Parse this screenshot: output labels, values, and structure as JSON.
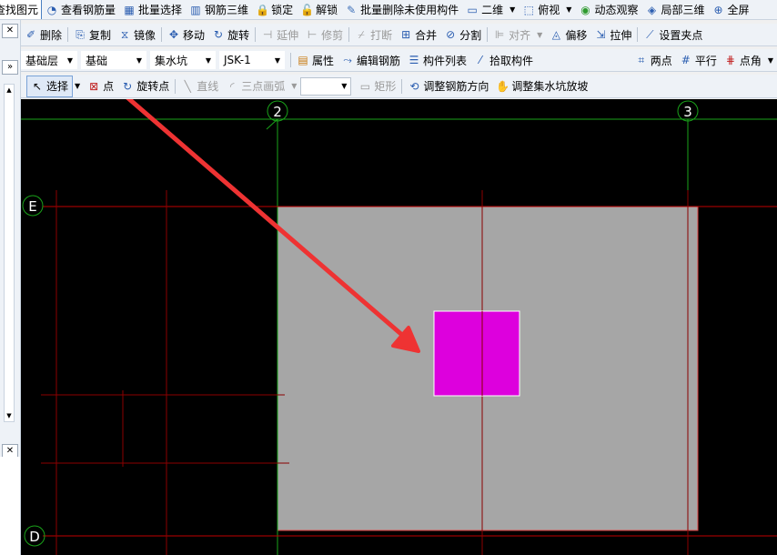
{
  "toolbar1": {
    "find_element": "查找图元",
    "view_rebar_qty": "查看钢筋量",
    "batch_select": "批量选择",
    "rebar_3d": "钢筋三维",
    "lock": "锁定",
    "unlock": "解锁",
    "batch_delete_unused": "批量删除未使用构件",
    "view_2d": "二维",
    "top_view": "俯视",
    "dynamic_observe": "动态观察",
    "local_3d": "局部三维",
    "fullscreen": "全屏"
  },
  "toolbar2": {
    "delete": "删除",
    "copy": "复制",
    "mirror": "镜像",
    "move": "移动",
    "rotate": "旋转",
    "extend": "延伸",
    "trim": "修剪",
    "break": "打断",
    "merge": "合并",
    "split": "分割",
    "align": "对齐",
    "offset": "偏移",
    "stretch": "拉伸",
    "set_grip": "设置夹点"
  },
  "toolbar3": {
    "layer": "基础层",
    "category": "基础",
    "component_type": "集水坑",
    "component_name": "JSK-1",
    "properties": "属性",
    "edit_rebar": "编辑钢筋",
    "component_list": "构件列表",
    "pick_component": "拾取构件",
    "two_point": "两点",
    "parallel": "平行",
    "point_angle": "点角"
  },
  "toolbar4": {
    "select": "选择",
    "point": "点",
    "rotate_point": "旋转点",
    "line": "直线",
    "three_point_arc": "三点画弧",
    "rect": "矩形",
    "adjust_rebar_dir": "调整钢筋方向",
    "adjust_pit_slope": "调整集水坑放坡"
  },
  "canvas": {
    "axis_labels": {
      "col_2": "2",
      "col_3": "3",
      "row_E": "E",
      "row_D": "D"
    },
    "colors": {
      "background": "#000000",
      "slab": "#a6a6a6",
      "pit": "#dd00dd",
      "axis_line": "#c00000",
      "grid_green": "#1aa31a",
      "arrow": "#ee3333"
    }
  }
}
